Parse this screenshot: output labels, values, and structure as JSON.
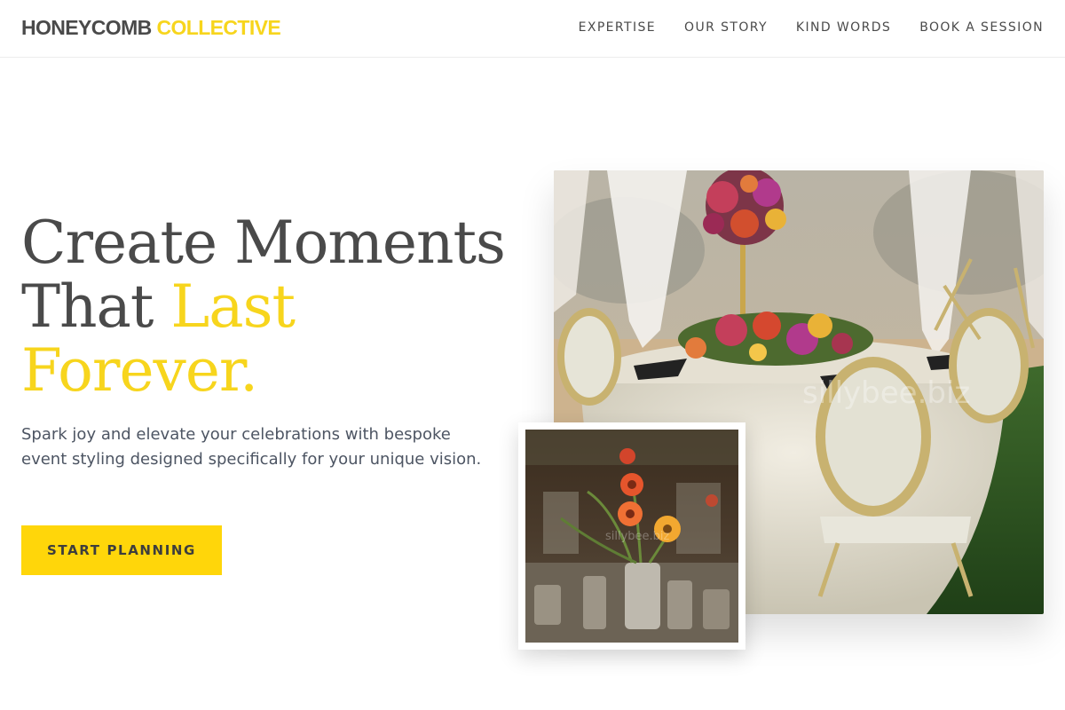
{
  "header": {
    "logo_primary": "HONEYCOMB",
    "logo_accent": "COLLECTIVE",
    "nav": [
      {
        "label": "EXPERTISE"
      },
      {
        "label": "OUR STORY"
      },
      {
        "label": "KIND WORDS"
      },
      {
        "label": "BOOK A SESSION"
      }
    ]
  },
  "hero": {
    "headline_line1": "Create Moments",
    "headline_line2_plain": "That",
    "headline_line2_accent": "Last",
    "headline_line3_accent": "Forever.",
    "subtitle": "Spark joy and elevate your celebrations with bespoke event styling designed specifically for your unique vision.",
    "cta_label": "START PLANNING"
  },
  "images": {
    "main_watermark": "sillybee.biz",
    "inset_watermark": "sillybee.biz"
  },
  "colors": {
    "accent": "#ffd60a",
    "text_dark": "#4a4a4a",
    "text_body": "#4d5563"
  }
}
